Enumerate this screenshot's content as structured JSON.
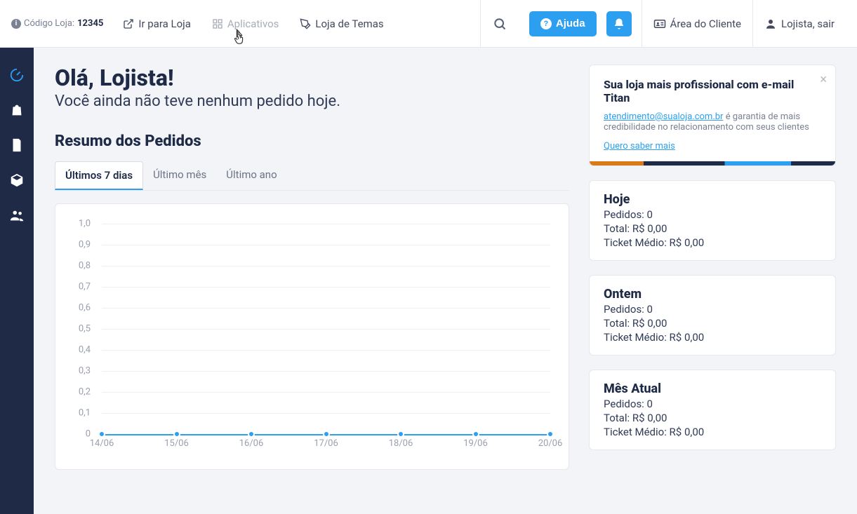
{
  "header": {
    "store_code_label": "Código Loja:",
    "store_code_value": "12345",
    "nav": {
      "go_to_store": "Ir para Loja",
      "apps": "Aplicativos",
      "theme_store": "Loja de Temas"
    },
    "help_label": "Ajuda",
    "client_area": "Área do Cliente",
    "logout": "Lojista, sair"
  },
  "greeting": {
    "title": "Olá, Lojista!",
    "subtitle": "Você ainda não teve nenhum pedido hoje."
  },
  "orders_summary": {
    "title": "Resumo dos Pedidos",
    "tabs": [
      "Últimos 7 dias",
      "Último mês",
      "Último ano"
    ],
    "active_tab": 0
  },
  "chart_data": {
    "type": "line",
    "categories": [
      "14/06",
      "15/06",
      "16/06",
      "17/06",
      "18/06",
      "19/06",
      "20/06"
    ],
    "values": [
      0,
      0,
      0,
      0,
      0,
      0,
      0
    ],
    "ylim": [
      0,
      1.0
    ],
    "yticks": [
      "0",
      "0,1",
      "0,2",
      "0,3",
      "0,4",
      "0,5",
      "0,6",
      "0,7",
      "0,8",
      "0,9",
      "1,0"
    ],
    "xlabel": "",
    "ylabel": "",
    "title": ""
  },
  "promo": {
    "title": "Sua loja mais profissional com e-mail Titan",
    "email": "atendimento@sualoja.com.br",
    "body_tail": " é garantia de mais credibilidade no relacionamento com seus clientes",
    "cta": "Quero saber mais"
  },
  "stats": [
    {
      "title": "Hoje",
      "orders_label": "Pedidos:",
      "orders_value": "0",
      "total_label": "Total:",
      "total_value": "R$ 0,00",
      "ticket_label": "Ticket Médio:",
      "ticket_value": "R$ 0,00"
    },
    {
      "title": "Ontem",
      "orders_label": "Pedidos:",
      "orders_value": "0",
      "total_label": "Total:",
      "total_value": "R$ 0,00",
      "ticket_label": "Ticket Médio:",
      "ticket_value": "R$ 0,00"
    },
    {
      "title": "Mês Atual",
      "orders_label": "Pedidos:",
      "orders_value": "0",
      "total_label": "Total:",
      "total_value": "R$ 0,00",
      "ticket_label": "Ticket Médio:",
      "ticket_value": "R$ 0,00"
    }
  ]
}
